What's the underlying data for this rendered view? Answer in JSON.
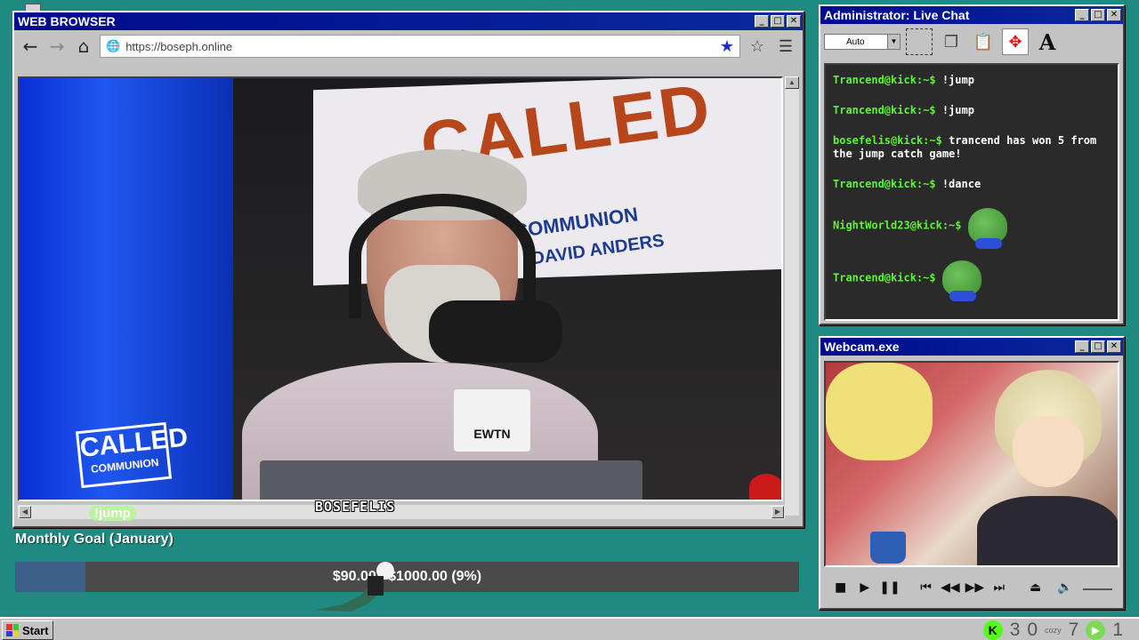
{
  "browser": {
    "title": "WEB BROWSER",
    "url": "https://boseph.online",
    "nav": {
      "back": "←",
      "forward": "→",
      "home": "⌂"
    },
    "icons": {
      "globe": "globe-icon",
      "bookmark": "star-filled-icon",
      "bookmark_add": "star-outline-icon",
      "menu": "hamburger-menu-icon"
    },
    "stream_sign": {
      "line1": "CALLED",
      "line2": "COMMUNION",
      "line3": "DAVID ANDERS"
    },
    "stream_logo": {
      "line1": "CALLED",
      "line2": "COMMUNION"
    },
    "mic_flag": "EWTN",
    "overlay": {
      "name": "BOSEFELIS",
      "jump": "!jump"
    }
  },
  "goal": {
    "title": "Monthly Goal (January)",
    "text": "$90.00 / $1000.00 (9%)",
    "progress_percent": 9,
    "fill_color": "#3d5f8a"
  },
  "chat": {
    "title": "Administrator: Live Chat",
    "zoom_select": "Auto",
    "messages": [
      {
        "user": "Trancend@kick:~$",
        "text": "!jump"
      },
      {
        "user": "Trancend@kick:~$",
        "text": "!jump"
      },
      {
        "user": "bosefelis@kick:~$",
        "text": "trancend has won 5 from the jump catch game!"
      },
      {
        "user": "Trancend@kick:~$",
        "text": "!dance"
      },
      {
        "user": "NightWorld23@kick:~$",
        "text": ""
      },
      {
        "user": "Trancend@kick:~$",
        "text": ""
      }
    ],
    "user_color": "#5ff23a"
  },
  "webcam": {
    "title": "Webcam.exe",
    "controls": {
      "stop": "■",
      "play": "▶",
      "pause": "❚❚",
      "prev": "⏮",
      "rewind": "◀◀",
      "forward": "▶▶",
      "next": "⏭",
      "eject": "⏏",
      "volume": "🔈"
    }
  },
  "taskbar": {
    "start_label": "Start",
    "kick_count": "3",
    "viewer_count": "0",
    "small_label": "cozy",
    "count_7": "7",
    "yt_count": "1"
  }
}
